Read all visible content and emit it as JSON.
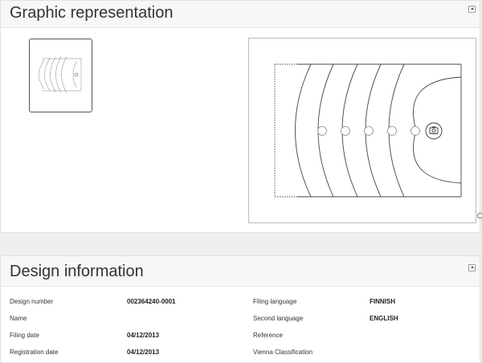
{
  "graphic": {
    "title": "Graphic representation"
  },
  "design": {
    "title": "Design information",
    "rows": [
      {
        "label": "Design number",
        "value": "002364240-0001",
        "label2": "Filing language",
        "value2": "FINNISH"
      },
      {
        "label": "Name",
        "value": "",
        "label2": "Second language",
        "value2": "ENGLISH"
      },
      {
        "label": "Filing date",
        "value": "04/12/2013",
        "label2": "Reference",
        "value2": ""
      },
      {
        "label": "Registration date",
        "value": "04/12/2013",
        "label2": "Vienna Classification",
        "value2": ""
      }
    ]
  },
  "icons": {
    "collapse": "chevron-up-icon",
    "zoom": "zoom-icon",
    "camera": "camera-icon"
  }
}
